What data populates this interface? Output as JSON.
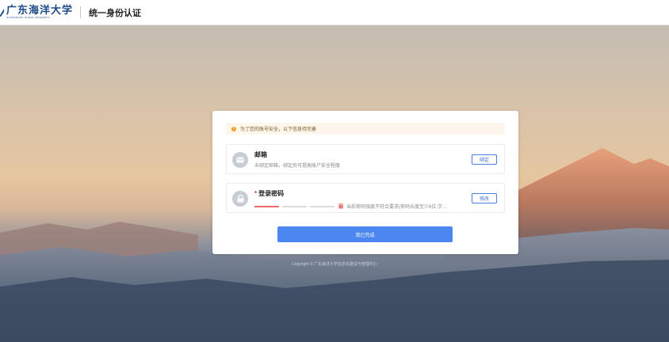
{
  "header": {
    "logo_cn": "广东海洋大学",
    "logo_en": "GUANGDONG OCEAN UNIVERSITY",
    "system_title": "统一身份认证"
  },
  "notice": {
    "text": "为了您的账号安全，以下信息待完善"
  },
  "email": {
    "title": "邮箱",
    "subtitle": "未绑定邮箱，绑定后可提高账户安全程度",
    "button": "绑定"
  },
  "password": {
    "required_mark": "*",
    "title": "登录密码",
    "strength_mark": "弱",
    "strength_message": "当前密码强度不符合要求(密码长度至少6位,字...",
    "button": "修改",
    "strength_level": 1,
    "strength_levels": 3
  },
  "done_button": "我已完成",
  "copyright": "Copyright © 广东海洋大学信息化建设与管理中心",
  "colors": {
    "primary": "#4c86f0",
    "warning": "#f0a020",
    "danger": "#e03a3a"
  }
}
